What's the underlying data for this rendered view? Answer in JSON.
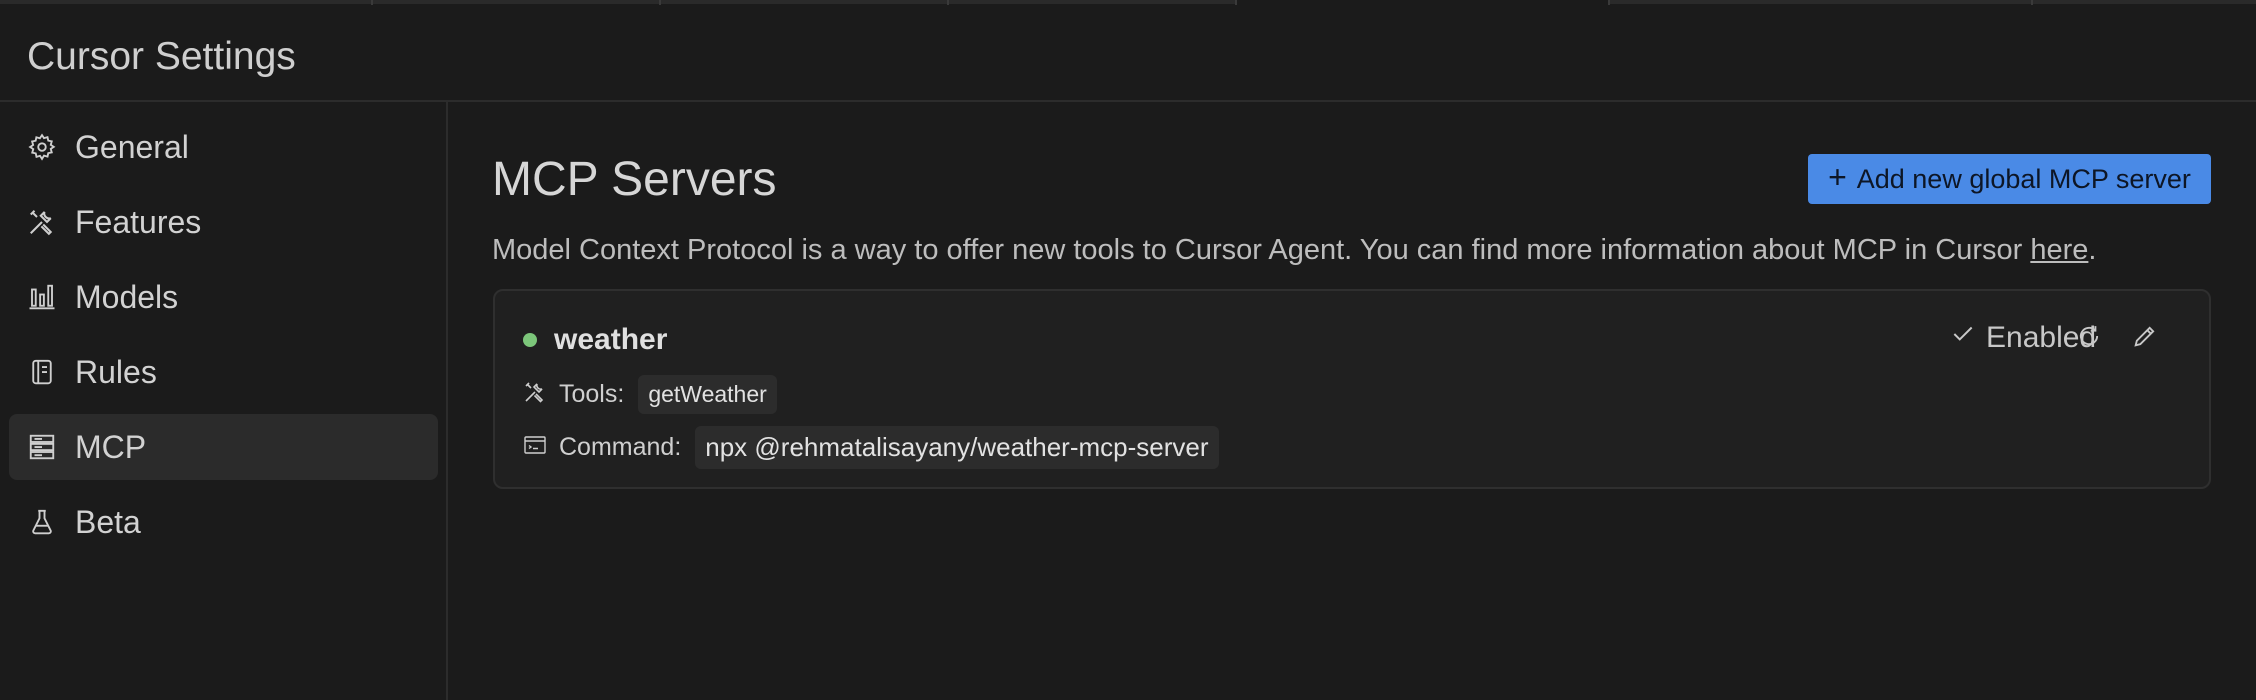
{
  "header": {
    "title": "Cursor Settings"
  },
  "sidebar": {
    "items": [
      {
        "label": "General",
        "icon": "gear-icon"
      },
      {
        "label": "Features",
        "icon": "tools-icon"
      },
      {
        "label": "Models",
        "icon": "bar-chart-icon"
      },
      {
        "label": "Rules",
        "icon": "document-icon"
      },
      {
        "label": "MCP",
        "icon": "server-icon",
        "active": true
      },
      {
        "label": "Beta",
        "icon": "flask-icon"
      }
    ]
  },
  "main": {
    "title": "MCP Servers",
    "add_button": {
      "label": "Add new global MCP server",
      "icon": "plus"
    },
    "description": "Model Context Protocol is a way to offer new tools to Cursor Agent. You can find more information about MCP in Cursor ",
    "description_link": "here",
    "description_end": "."
  },
  "server": {
    "name": "weather",
    "status_color": "#7cc67a",
    "enabled_label": "Enabled",
    "tools_label": "Tools:",
    "tools": [
      "getWeather"
    ],
    "command_label": "Command:",
    "command": "npx @rehmatalisayany/weather-mcp-server"
  },
  "colors": {
    "accent": "#4a8ae6",
    "background": "#1b1b1b",
    "card": "#202020"
  }
}
